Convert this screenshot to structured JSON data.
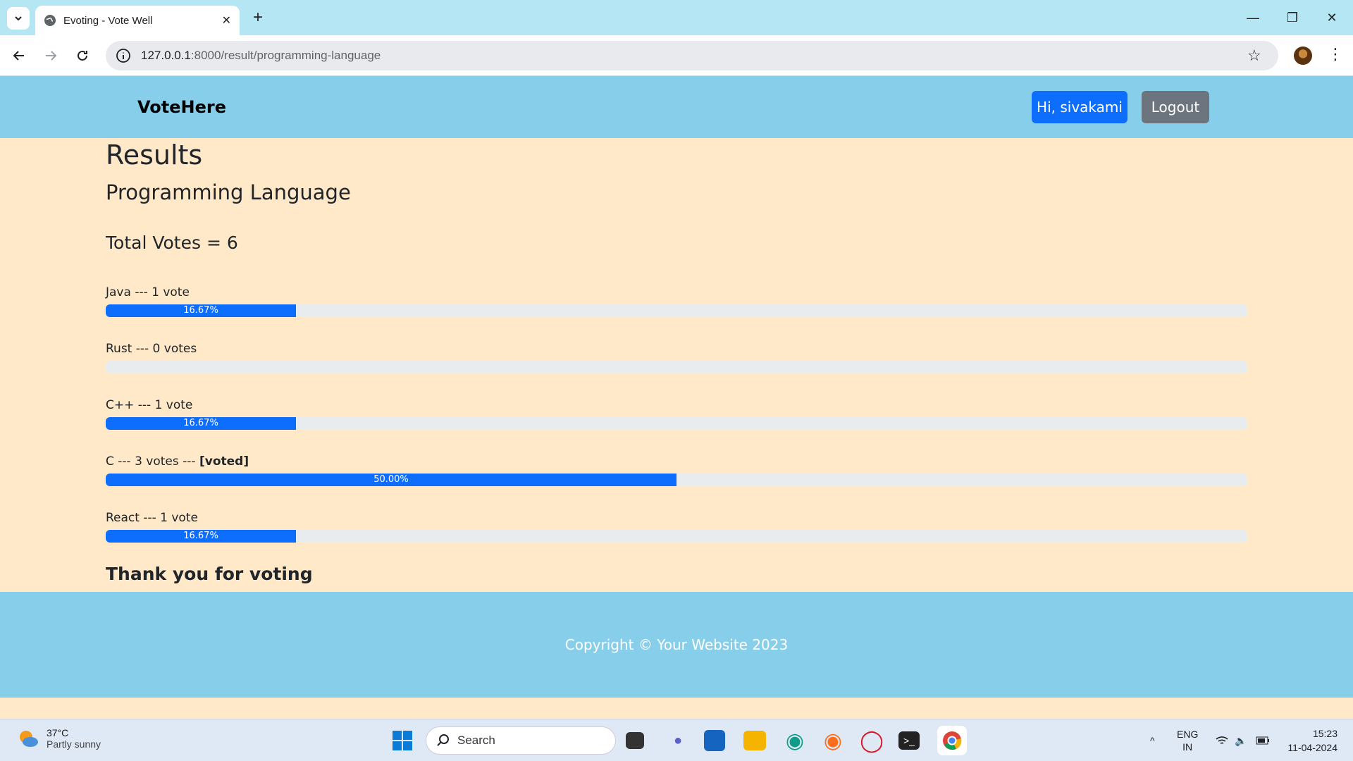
{
  "browser": {
    "tab_title": "Evoting - Vote Well",
    "url_host": "127.0.0.1",
    "url_path": ":8000/result/programming-language"
  },
  "navbar": {
    "brand": "VoteHere",
    "greeting": "Hi, sivakami",
    "logout": "Logout"
  },
  "results": {
    "heading": "Results",
    "poll": "Programming Language",
    "total": "Total Votes = 6",
    "items": [
      {
        "label": "Java --- 1 vote",
        "voted": "",
        "percent": 16.67,
        "percent_label": "16.67%"
      },
      {
        "label": "Rust --- 0 votes",
        "voted": "",
        "percent": 0,
        "percent_label": ""
      },
      {
        "label": "C++ --- 1 vote",
        "voted": "",
        "percent": 16.67,
        "percent_label": "16.67%"
      },
      {
        "label": "C --- 3 votes --- ",
        "voted": "[voted]",
        "percent": 50,
        "percent_label": "50.00%"
      },
      {
        "label": "React --- 1 vote",
        "voted": "",
        "percent": 16.67,
        "percent_label": "16.67%"
      }
    ],
    "thanks": "Thank you for voting"
  },
  "footer": {
    "copyright": "Copyright © Your Website 2023"
  },
  "taskbar": {
    "temp": "37°C",
    "weather": "Partly sunny",
    "search": "Search",
    "lang1": "ENG",
    "lang2": "IN",
    "time": "15:23",
    "date": "11-04-2024"
  },
  "colors": {
    "accent": "#0d6efd",
    "navbar": "#87ceeb",
    "page_bg": "#ffe9c9"
  }
}
